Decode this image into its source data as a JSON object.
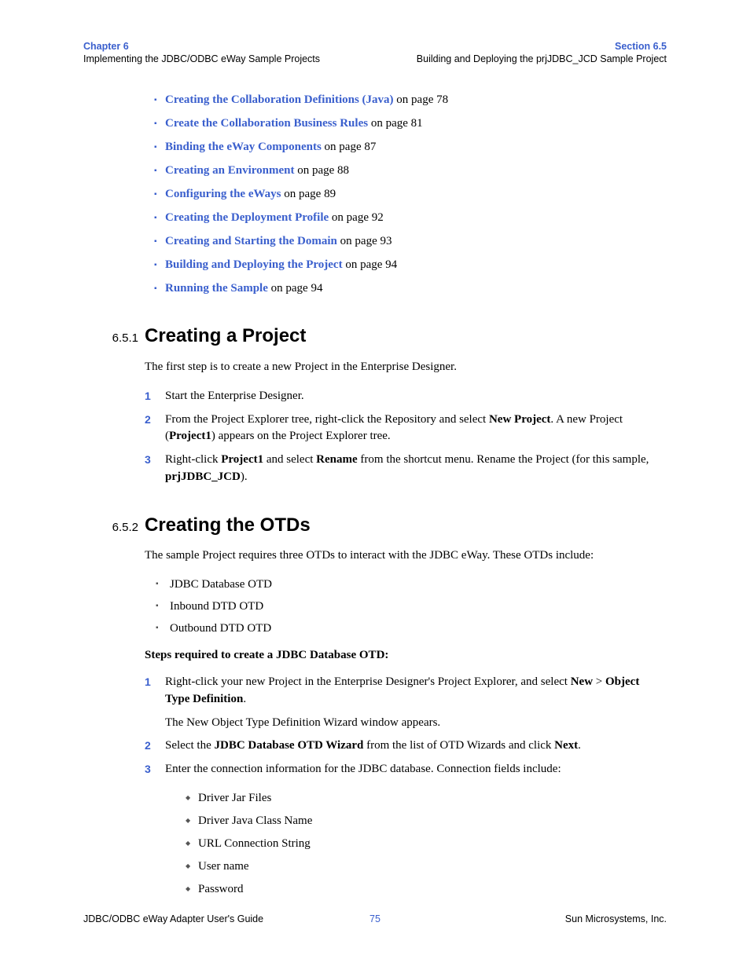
{
  "header": {
    "chapter": "Chapter 6",
    "chapter_sub": "Implementing the JDBC/ODBC eWay Sample Projects",
    "section": "Section 6.5",
    "section_sub": "Building and Deploying the prjJDBC_JCD Sample Project"
  },
  "toc": [
    {
      "link": "Creating the Collaboration Definitions (Java)",
      "suffix": " on page 78"
    },
    {
      "link": "Create the Collaboration Business Rules",
      "suffix": " on page 81"
    },
    {
      "link": "Binding the eWay Components",
      "suffix": " on page 87"
    },
    {
      "link": "Creating an Environment",
      "suffix": " on page 88"
    },
    {
      "link": "Configuring the eWays",
      "suffix": " on page 89"
    },
    {
      "link": "Creating the Deployment Profile",
      "suffix": " on page 92"
    },
    {
      "link": "Creating and Starting the Domain",
      "suffix": " on page 93"
    },
    {
      "link": "Building and Deploying the Project",
      "suffix": " on page 94"
    },
    {
      "link": "Running the Sample",
      "suffix": " on page 94"
    }
  ],
  "s651": {
    "num": "6.5.1",
    "title": "Creating a Project",
    "intro": "The first step is to create a new Project in the Enterprise Designer.",
    "steps": {
      "s1": "Start the Enterprise Designer.",
      "s2a": "From the Project Explorer tree, right-click the Repository and select ",
      "s2b": "New Project",
      "s2c": ". A new Project (",
      "s2d": "Project1",
      "s2e": ") appears on the Project Explorer tree.",
      "s3a": "Right-click ",
      "s3b": "Project1",
      "s3c": " and select ",
      "s3d": "Rename",
      "s3e": " from the shortcut menu. Rename the Project (for this sample, ",
      "s3f": "prjJDBC_JCD",
      "s3g": ")."
    }
  },
  "s652": {
    "num": "6.5.2",
    "title": "Creating the OTDs",
    "intro": "The sample Project requires three OTDs to interact with the JDBC eWay. These OTDs include:",
    "otds": [
      "JDBC Database OTD",
      "Inbound DTD OTD",
      "Outbound DTD OTD"
    ],
    "steps_heading": "Steps required to create a JDBC Database OTD:",
    "steps": {
      "s1a": "Right-click your new Project in the Enterprise Designer's Project Explorer, and select ",
      "s1b": "New",
      "s1c": " > ",
      "s1d": "Object Type Definition",
      "s1e": ".",
      "s1_after": "The New Object Type Definition Wizard window appears.",
      "s2a": "Select the ",
      "s2b": "JDBC Database OTD Wizard",
      "s2c": " from the list of OTD Wizards and click ",
      "s2d": "Next",
      "s2e": ".",
      "s3": "Enter the connection information for the JDBC database. Connection fields include:"
    },
    "conn_fields": [
      "Driver Jar Files",
      "Driver Java Class Name",
      "URL Connection String",
      "User name",
      "Password"
    ]
  },
  "footer": {
    "left": "JDBC/ODBC eWay Adapter User's Guide",
    "center": "75",
    "right": "Sun Microsystems, Inc."
  }
}
